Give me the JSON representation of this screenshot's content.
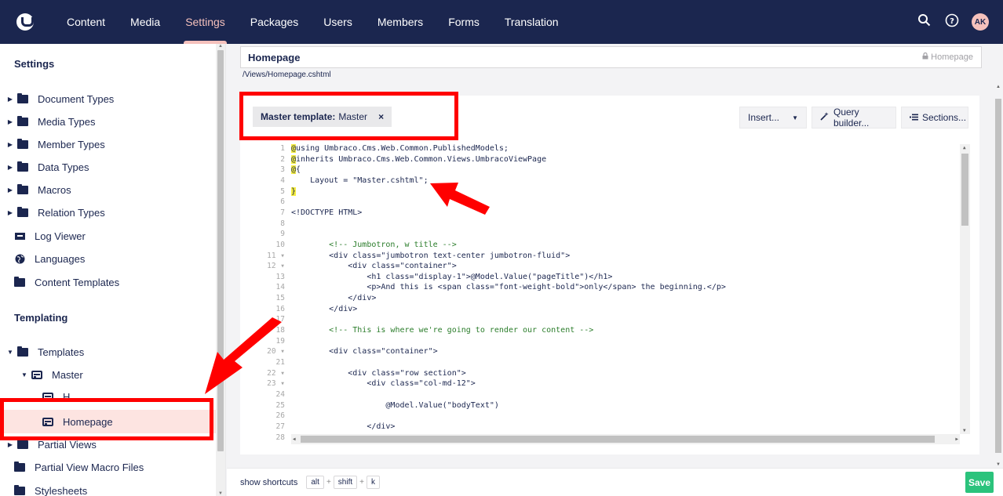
{
  "topnav": {
    "items": [
      {
        "label": "Content",
        "active": false
      },
      {
        "label": "Media",
        "active": false
      },
      {
        "label": "Settings",
        "active": true
      },
      {
        "label": "Packages",
        "active": false
      },
      {
        "label": "Users",
        "active": false
      },
      {
        "label": "Members",
        "active": false
      },
      {
        "label": "Forms",
        "active": false
      },
      {
        "label": "Translation",
        "active": false
      }
    ],
    "avatar_initials": "AK",
    "search_icon": "search-icon",
    "help_icon": "help-icon"
  },
  "sidebar": {
    "settings_heading": "Settings",
    "settings_items": [
      {
        "label": "Document Types",
        "icon": "folder-icon",
        "expandable": true
      },
      {
        "label": "Media Types",
        "icon": "folder-icon",
        "expandable": true
      },
      {
        "label": "Member Types",
        "icon": "folder-icon",
        "expandable": true
      },
      {
        "label": "Data Types",
        "icon": "folder-icon",
        "expandable": true
      },
      {
        "label": "Macros",
        "icon": "folder-icon",
        "expandable": true
      },
      {
        "label": "Relation Types",
        "icon": "folder-icon",
        "expandable": true
      },
      {
        "label": "Log Viewer",
        "icon": "log-viewer-icon",
        "expandable": false
      },
      {
        "label": "Languages",
        "icon": "globe-icon",
        "expandable": false
      },
      {
        "label": "Content Templates",
        "icon": "folder-icon",
        "expandable": false
      }
    ],
    "templating_heading": "Templating",
    "templating_items": [
      {
        "label": "Templates",
        "icon": "folder-icon",
        "expanded": true
      },
      {
        "label": "Master",
        "icon": "template-icon",
        "expanded": true
      },
      {
        "label": "H",
        "icon": "template-icon"
      },
      {
        "label": "Homepage",
        "icon": "template-icon",
        "selected": true
      },
      {
        "label": "Partial Views",
        "icon": "folder-icon",
        "expandable": true
      },
      {
        "label": "Partial View Macro Files",
        "icon": "folder-icon"
      },
      {
        "label": "Stylesheets",
        "icon": "folder-icon"
      }
    ]
  },
  "editor": {
    "name": "Homepage",
    "alias": "Homepage",
    "path": "/Views/Homepage.cshtml",
    "master_label": "Master template:",
    "master_value": "Master",
    "master_remove": "×",
    "insert_label": "Insert...",
    "query_builder_label": "Query builder...",
    "sections_label": "Sections...",
    "line_numbers": [
      "1",
      "2",
      "3",
      "4",
      "5",
      "6",
      "7",
      "8",
      "9",
      "10",
      "11",
      "12",
      "13",
      "14",
      "15",
      "16",
      "17",
      "18",
      "19",
      "20",
      "21",
      "22",
      "23",
      "24",
      "25",
      "26",
      "27",
      "28"
    ],
    "code_lines": [
      "@using Umbraco.Cms.Web.Common.PublishedModels;",
      "@inherits Umbraco.Cms.Web.Common.Views.UmbracoViewPage",
      "@{",
      "    Layout = \"Master.cshtml\";",
      "}",
      "",
      "<!DOCTYPE HTML>",
      "",
      "",
      "        <!-- Jumbotron, w title -->",
      "        <div class=\"jumbotron text-center jumbotron-fluid\">",
      "            <div class=\"container\">",
      "                <h1 class=\"display-1\">@Model.Value(\"pageTitle\")</h1>",
      "                <p>And this is <span class=\"font-weight-bold\">only</span> the beginning.</p>",
      "            </div>",
      "        </div>",
      "",
      "        <!-- This is where we're going to render our content -->",
      "",
      "        <div class=\"container\">",
      "",
      "            <div class=\"row section\">",
      "                <div class=\"col-md-12\">",
      "",
      "                    @Model.Value(\"bodyText\")",
      "",
      "                </div>",
      ""
    ]
  },
  "footer": {
    "shortcuts_label": "show shortcuts",
    "keys": [
      "alt",
      "shift",
      "k"
    ],
    "plus": "+",
    "save_label": "Save"
  },
  "colors": {
    "nav_bg": "#1b264f",
    "nav_active": "#f5c1bc",
    "save_green": "#2bc37c",
    "annotation_red": "#ff0000"
  }
}
